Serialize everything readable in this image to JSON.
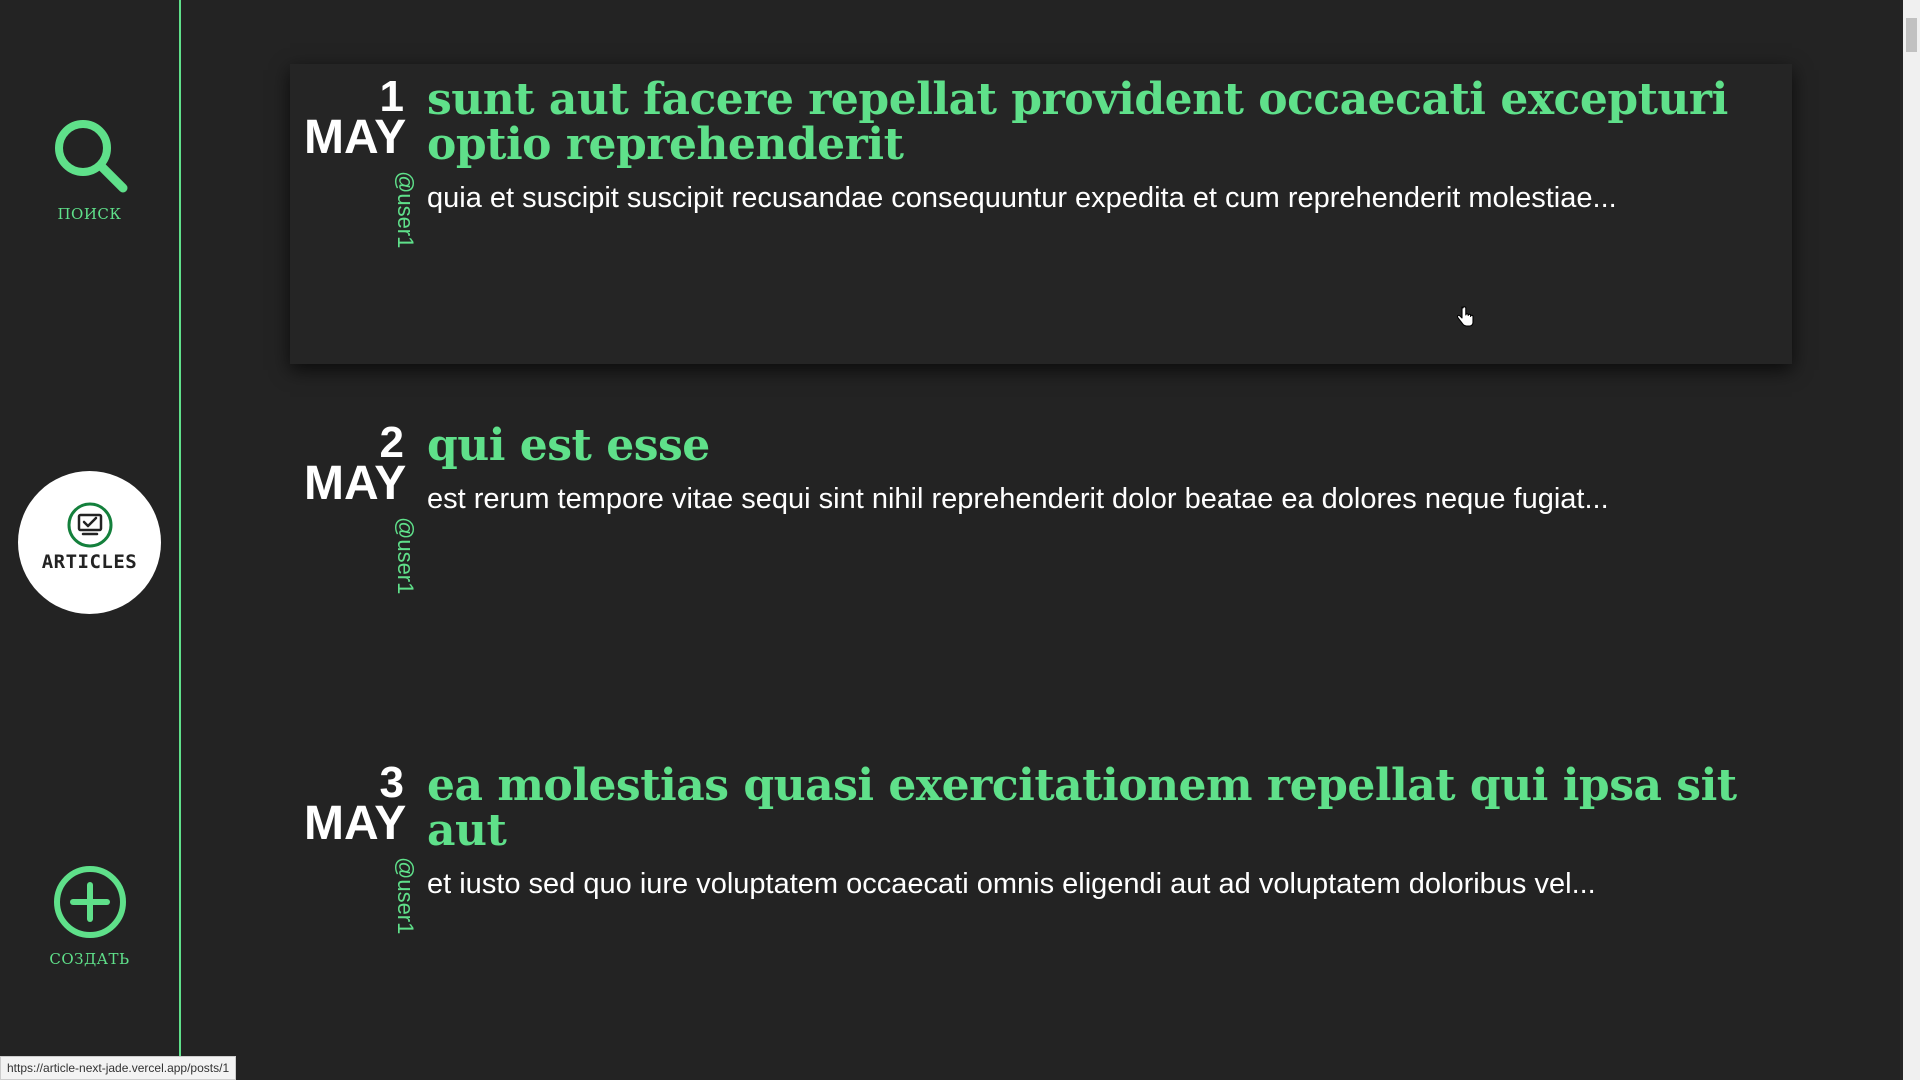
{
  "sidebar": {
    "search_label": "ПОИСК",
    "articles_label": "ARTICLES",
    "create_label": "СОЗДАТЬ"
  },
  "posts": [
    {
      "day": "1",
      "month": "MAY",
      "author": "@user1",
      "title": "sunt aut facere repellat provident occaecati excepturi optio reprehenderit",
      "excerpt": "quia et suscipit suscipit recusandae consequuntur expedita et cum reprehenderit molestiae..."
    },
    {
      "day": "2",
      "month": "MAY",
      "author": "@user1",
      "title": "qui est esse",
      "excerpt": "est rerum tempore vitae sequi sint nihil reprehenderit dolor beatae ea dolores neque fugiat..."
    },
    {
      "day": "3",
      "month": "MAY",
      "author": "@user1",
      "title": "ea molestias quasi exercitationem repellat qui ipsa sit aut",
      "excerpt": "et iusto sed quo iure voluptatem occaecati omnis eligendi aut ad voluptatem doloribus vel..."
    }
  ],
  "status_url": "https://article-next-jade.vercel.app/posts/1",
  "colors": {
    "accent": "#5fe08a",
    "background": "#232323",
    "text": "#ffffff"
  }
}
